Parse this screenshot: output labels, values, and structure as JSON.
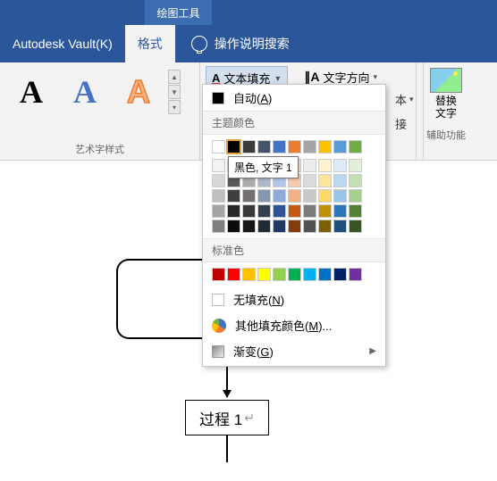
{
  "context_tab": "绘图工具",
  "tabs": {
    "vault": "Autodesk Vault(K)",
    "format": "格式",
    "search_placeholder": "操作说明搜索"
  },
  "ribbon": {
    "wordart_label": "艺术字样式",
    "text_fill": "文本填充",
    "text_direction": "文字方向",
    "link_text": "本",
    "link_connect": "接",
    "replace_text": "替换\n文字",
    "accessibility": "辅助功能"
  },
  "dropdown": {
    "auto": "自动(A)",
    "theme_header": "主题颜色",
    "std_header": "标准色",
    "no_fill": "无填充(N)",
    "more_colors": "其他填充颜色(M)...",
    "gradient": "渐变(G)",
    "tooltip": "黑色, 文字 1",
    "theme_row1": [
      "#ffffff",
      "#000000",
      "#3a3a3a",
      "#44546a",
      "#4472c4",
      "#ed7d31",
      "#a5a5a5",
      "#ffc000",
      "#5b9bd5",
      "#70ad47"
    ],
    "theme_shades": [
      [
        "#f2f2f2",
        "#7f7f7f",
        "#d0cece",
        "#d6dce4",
        "#d9e2f3",
        "#fbe5d5",
        "#ededed",
        "#fff2cc",
        "#deebf6",
        "#e2efd9"
      ],
      [
        "#d8d8d8",
        "#595959",
        "#aeabab",
        "#adb9ca",
        "#b4c6e7",
        "#f7cbac",
        "#dbdbdb",
        "#fee599",
        "#bdd7ee",
        "#c5e0b3"
      ],
      [
        "#bfbfbf",
        "#3f3f3f",
        "#757070",
        "#8496b0",
        "#8eaadb",
        "#f4b183",
        "#c9c9c9",
        "#ffd965",
        "#9cc3e5",
        "#a8d08d"
      ],
      [
        "#a5a5a5",
        "#262626",
        "#3a3838",
        "#333f4f",
        "#2f5496",
        "#c55a11",
        "#7b7b7b",
        "#bf9000",
        "#2e75b5",
        "#538135"
      ],
      [
        "#7f7f7f",
        "#0c0c0c",
        "#171616",
        "#222a35",
        "#1f3864",
        "#833c0b",
        "#525252",
        "#7f6000",
        "#1e4e79",
        "#375623"
      ]
    ],
    "standard": [
      "#c00000",
      "#ff0000",
      "#ffc000",
      "#ffff00",
      "#92d050",
      "#00b050",
      "#00b0f0",
      "#0070c0",
      "#002060",
      "#7030a0"
    ]
  },
  "canvas": {
    "process_label": "过程 1"
  }
}
